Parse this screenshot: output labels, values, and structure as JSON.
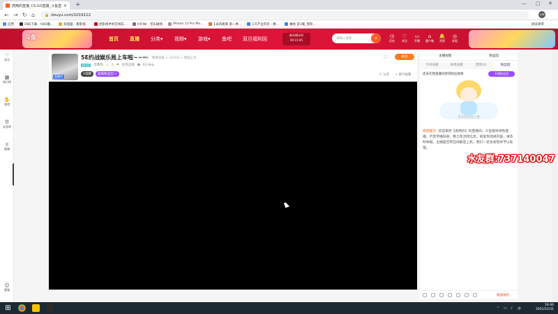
{
  "browser": {
    "tab_title": "虎两的直播_CS:GO直播_斗鱼直...",
    "tab_close": "✕",
    "new_tab": "+",
    "window_controls": [
      "—",
      "▢",
      "✕"
    ],
    "nav": {
      "back": "←",
      "forward": "→",
      "reload": "↻",
      "home": "⌂"
    },
    "url": "douyu.com/1019112",
    "lock": "🔒",
    "profile": "大神",
    "bookmarks": [
      {
        "label": "应用",
        "color": "#4a90e2"
      },
      {
        "label": "OBS下载 - OBS播...",
        "color": "#333333"
      },
      {
        "label": "扣电脑 - 看影视...",
        "color": "#f5a623"
      },
      {
        "label": "虎影视手机在线实...",
        "color": "#d0021b"
      },
      {
        "label": "HIFINI - 音乐磁场",
        "color": "#777777"
      },
      {
        "label": "iPhone 13 Pro Ma...",
        "color": "#999999"
      },
      {
        "label": "1米风格库 第一季...",
        "color": "#e86a3a"
      },
      {
        "label": "1只产业内页 - 精...",
        "color": "#2d8cf0"
      },
      {
        "label": "番组 首1集_郭欢...",
        "color": "#2d8cf0"
      }
    ],
    "reading_list": "阅读清单"
  },
  "douyu_header": {
    "logo_text": "斗鱼",
    "nav_items": [
      {
        "label": "首页",
        "active": false
      },
      {
        "label": "直播",
        "active": true
      },
      {
        "label": "分类▾",
        "active": false
      },
      {
        "label": "视频▾",
        "active": false
      },
      {
        "label": "游戏▾",
        "active": false
      },
      {
        "label": "鱼吧",
        "active": false
      },
      {
        "label": "双旦福利回",
        "active": false
      }
    ],
    "promo_line1": "新年倒计时",
    "promo_line2": "00:15:45",
    "search_placeholder": "请输入搜索",
    "search_icon": "⌕",
    "icons": [
      {
        "glyph": "◷",
        "label": "历史"
      },
      {
        "glyph": "♡",
        "label": "关注"
      },
      {
        "glyph": "▭",
        "label": "开播"
      },
      {
        "glyph": "⌂",
        "label": "客户端"
      },
      {
        "glyph": "🔔",
        "label": "消息"
      },
      {
        "glyph": "◎",
        "label": "发现"
      }
    ]
  },
  "sidebar": {
    "items": [
      {
        "glyph": "♡",
        "label": "关注"
      },
      {
        "glyph": "▦",
        "label": "排行榜"
      },
      {
        "glyph": "✋",
        "label": "游戏"
      },
      {
        "glyph": "☰",
        "label": "云游戏"
      },
      {
        "glyph": "♕",
        "label": "赛事"
      },
      {
        "glyph": "☺",
        "label": "客服"
      }
    ]
  },
  "room": {
    "title": "5E约战娱乐局上车啦~~~",
    "report": "举报",
    "category": "网游竞技 > CS:GO > 帮助上车",
    "live_badge": "直播中",
    "level": "LV.21",
    "owner": "虎两你",
    "heat": "0",
    "contributors": "住宅正版",
    "viewers": "62.8kg",
    "v_badge": "V观察",
    "p_badge": "超级粉丝团 >",
    "follow": "关注",
    "share": "分享",
    "report_link": "看行报警"
  },
  "right_panel": {
    "top_left": "主播投稿",
    "top_right": "粉丝团",
    "tabs": [
      {
        "label": "今日贡献",
        "on": false
      },
      {
        "label": "本周贡献",
        "on": false
      },
      {
        "label": "贵宾(0)",
        "on": false
      },
      {
        "label": "粉丝团",
        "on": true
      }
    ],
    "fans_link": "还未在我直播间获得粉丝勋章",
    "fans_button": "开通粉丝团",
    "empty_tip": "还未有粉丝上榜",
    "system_label": "系统提示:",
    "system_text": "欢迎来到【虎两你】的直播间。斗鱼倡导绿色直播，严禁传播低俗、暴力及涉政信息，如发现违规内容，请及时举报。主播是否有在线解答上机，我们一定会发现并予以处理。",
    "gift_label": "赠送福利"
  },
  "overlay": {
    "watermark": "水友群:737140047"
  },
  "taskbar": {
    "time": "19:46",
    "date": "2021/12/31",
    "lang": "中"
  }
}
